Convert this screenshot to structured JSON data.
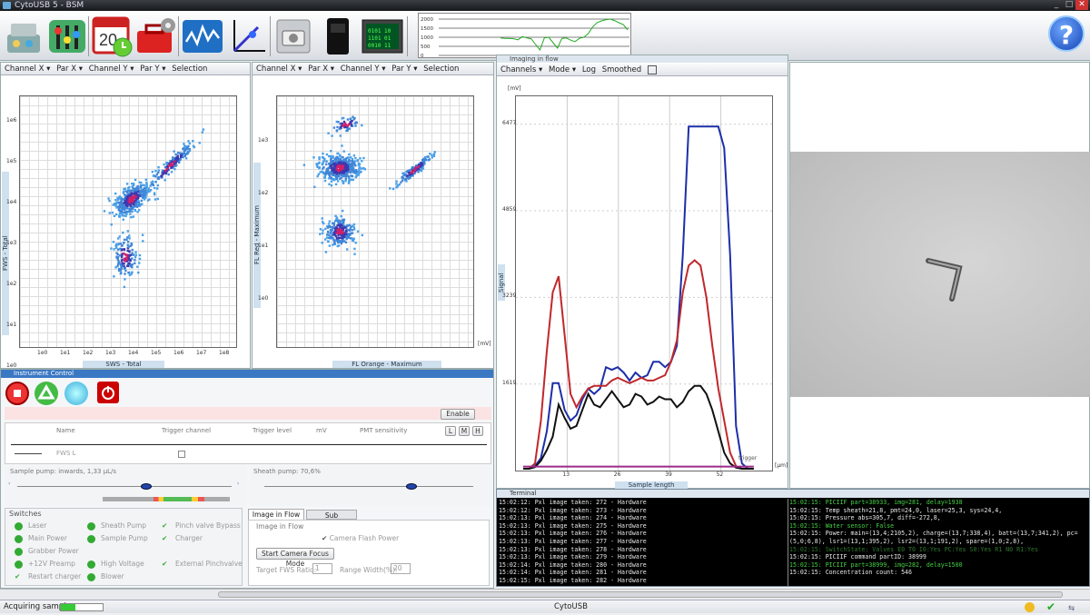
{
  "window": {
    "title": "CytoUSB 5 - BSM"
  },
  "toolbar": {
    "icons": [
      "instrument-icon",
      "settings-sliders-icon",
      "calendar-schedule-icon",
      "toolbox-icon",
      "signal-monitor-icon",
      "dotplot-icon",
      "camera-icon",
      "data-export-icon",
      "terminal-icon"
    ],
    "mini_chart": {
      "labels": [
        "2000",
        "1500",
        "1000",
        "500",
        "0"
      ],
      "series": [
        480,
        470,
        470,
        460,
        430,
        520,
        480,
        460,
        300,
        150,
        480,
        500,
        350,
        200,
        470,
        480,
        420,
        380,
        470,
        500,
        600,
        780,
        900,
        950,
        980,
        1000,
        960,
        900,
        850,
        700
      ]
    },
    "help_label": "?"
  },
  "plot1": {
    "toolbar": [
      "Channel X",
      "Par X",
      "Channel Y",
      "Par Y",
      "Selection"
    ],
    "x_title": "SWS - Total",
    "y_title": "FWS - Total",
    "x_ticks": [
      "1e0",
      "1e1",
      "1e2",
      "1e3",
      "1e4",
      "1e5",
      "1e6",
      "1e7",
      "1e8"
    ],
    "y_ticks": [
      "1e6",
      "1e5",
      "1e4",
      "1e3",
      "1e2",
      "1e1",
      "1e0"
    ]
  },
  "plot2": {
    "toolbar": [
      "Channel X",
      "Par X",
      "Channel Y",
      "Par Y",
      "Selection"
    ],
    "x_title": "FL Orange - Maximum",
    "y_title": "FL Red - Maximum",
    "y_ticks": [
      "1e3",
      "1e2",
      "1e1",
      "1e0"
    ],
    "unit": "[mV]"
  },
  "imaging": {
    "title": "Imaging in flow",
    "toolbar": [
      "Channels",
      "Mode",
      "Log",
      "Smoothed"
    ],
    "y_unit": "[mV]",
    "x_unit": "[µm]",
    "x_title": "Sample length",
    "y_title": "Signal",
    "y_ticks": [
      "6477",
      "4859",
      "3239",
      "1619"
    ],
    "x_ticks": [
      "13",
      "26",
      "39",
      "52"
    ],
    "trigger_label": "trigger",
    "chart_data": {
      "type": "line",
      "x_label": "Sample length",
      "y_label": "[mV]",
      "x_ticks": [
        "13",
        "26",
        "39",
        "52"
      ],
      "y_ticks": [
        "1619",
        "3239",
        "4859",
        "6477"
      ],
      "series": [
        {
          "color": "#1d2fa8",
          "values": [
            0,
            0,
            50,
            200,
            700,
            1600,
            1600,
            1100,
            900,
            1000,
            1300,
            1500,
            1400,
            1500,
            1900,
            1850,
            1900,
            1800,
            1650,
            1800,
            1700,
            1750,
            2000,
            2000,
            1900,
            2000,
            2300,
            4000,
            6400,
            6400,
            6400,
            6400,
            6400,
            6400,
            6000,
            4000,
            800,
            100,
            0,
            0
          ]
        },
        {
          "color": "#c0282c",
          "values": [
            0,
            0,
            100,
            900,
            2200,
            3300,
            3600,
            2500,
            1400,
            1150,
            1350,
            1500,
            1550,
            1550,
            1550,
            1650,
            1700,
            1650,
            1600,
            1650,
            1700,
            1650,
            1650,
            1700,
            1750,
            2000,
            2400,
            3300,
            3800,
            3900,
            3800,
            3200,
            2300,
            1500,
            900,
            300,
            50,
            0,
            0,
            0
          ]
        },
        {
          "color": "#111111",
          "values": [
            0,
            0,
            30,
            150,
            350,
            600,
            1200,
            950,
            750,
            800,
            1100,
            1400,
            1200,
            1150,
            1300,
            1450,
            1300,
            1150,
            1200,
            1400,
            1350,
            1200,
            1250,
            1350,
            1300,
            1300,
            1150,
            1250,
            1450,
            1550,
            1550,
            1400,
            1100,
            700,
            300,
            100,
            20,
            0,
            0,
            0
          ]
        },
        {
          "color": "#9b2b8a",
          "values": [
            40,
            40,
            40,
            40,
            40,
            40,
            40,
            40,
            40,
            40,
            40,
            40,
            40,
            40,
            40,
            40,
            40,
            40,
            40,
            40,
            40,
            40,
            40,
            40,
            40,
            40,
            40,
            40,
            40,
            40,
            40,
            40,
            40,
            40,
            40,
            40,
            40,
            40,
            40,
            40
          ]
        }
      ]
    }
  },
  "instrument": {
    "title": "Instrument Control",
    "enable_label": "Enable",
    "columns": [
      "Name",
      "Trigger channel",
      "Trigger level",
      "mV",
      "PMT sensitivity"
    ],
    "pmt_buttons": [
      "L",
      "M",
      "H"
    ],
    "row_name": "FWS L",
    "sample_pump": {
      "label": "Sample pump: inwards, 1,33 µL/s",
      "value": 0.6
    },
    "sheath_pump": {
      "label": "Sheath pump: 70,6%",
      "value": 0.706
    },
    "switches_title": "Switches",
    "switches_col1": [
      "Laser",
      "Main Power",
      "Grabber Power",
      "+12V Preamp",
      "Restart charger"
    ],
    "switches_col2": [
      "Sheath Pump",
      "Sample Pump",
      "",
      "High Voltage",
      "Blower"
    ],
    "switches_col3": [
      "Pinch valve Bypass",
      "Charger",
      "",
      "External Pinchvalve"
    ],
    "tabs": [
      "Image in Flow",
      "Sub"
    ],
    "group_title": "Image in Flow",
    "camera_flash": "Camera Flash Power",
    "focus_button": "Start Camera Focus Mode",
    "fws_ratio_label": "Target FWS Ratio:",
    "fws_ratio_value": "1",
    "range_label": "Range Width(%):",
    "range_value": "20"
  },
  "terminal": {
    "title": "Terminal",
    "left": [
      "15:02:12: Pxl image taken: 272 - Hardware",
      "15:02:12: Pxl image taken: 273 - Hardware",
      "15:02:13: Pxl image taken: 274 - Hardware",
      "15:02:13: Pxl image taken: 275 - Hardware",
      "15:02:13: Pxl image taken: 276 - Hardware",
      "15:02:13: Pxl image taken: 277 - Hardware",
      "15:02:13: Pxl image taken: 278 - Hardware",
      "15:02:13: Pxl image taken: 279 - Hardware",
      "15:02:14: Pxl image taken: 280 - Hardware",
      "15:02:14: Pxl image taken: 281 - Hardware",
      "15:02:15: Pxl image taken: 282 - Hardware"
    ],
    "right": [
      {
        "t": "15:02:15: PICIIF part=38933, img=281, delay=1938",
        "c": "#46d046"
      },
      {
        "t": "15:02:15: Temp sheath=21,8, pmt=24,0, laser=25,3, sys=24,4,",
        "c": "#e8e8e8"
      },
      {
        "t": "15:02:15: Pressure abs=305,7, diff=-272,8,",
        "c": "#e8e8e8"
      },
      {
        "t": "15:02:15: Water sensor: False",
        "c": "#46d046"
      },
      {
        "t": "15:02:15: Power: main=(13,4;2105,2), charge=(13,7;338,4), batt=(13,7;341,2), pc=",
        "c": "#e8e8e8"
      },
      {
        "t": "(5,0;6,8), lsr1=(13,1;395,2), lsr2=(13,1;191,2), spare=(1,0;2,8),",
        "c": "#e8e8e8"
      },
      {
        "t": "15:02:15: SwitchState: Valves E0 T0 I0:Yes PC:Yes S0:Yes R1 N0 R1:Yes",
        "c": "#2f7a2f"
      },
      {
        "t": "15:02:15: PICIIF command partID: 38999",
        "c": "#e8e8e8"
      },
      {
        "t": "15:02:15: PICIIF part=38999, img=282, delay=1500",
        "c": "#46d046"
      },
      {
        "t": "15:02:15: Concentration count: 546",
        "c": "#e8e8e8"
      }
    ]
  },
  "status": {
    "left": "Acquiring sample",
    "center": "CytoUSB",
    "progress": 0.35
  }
}
